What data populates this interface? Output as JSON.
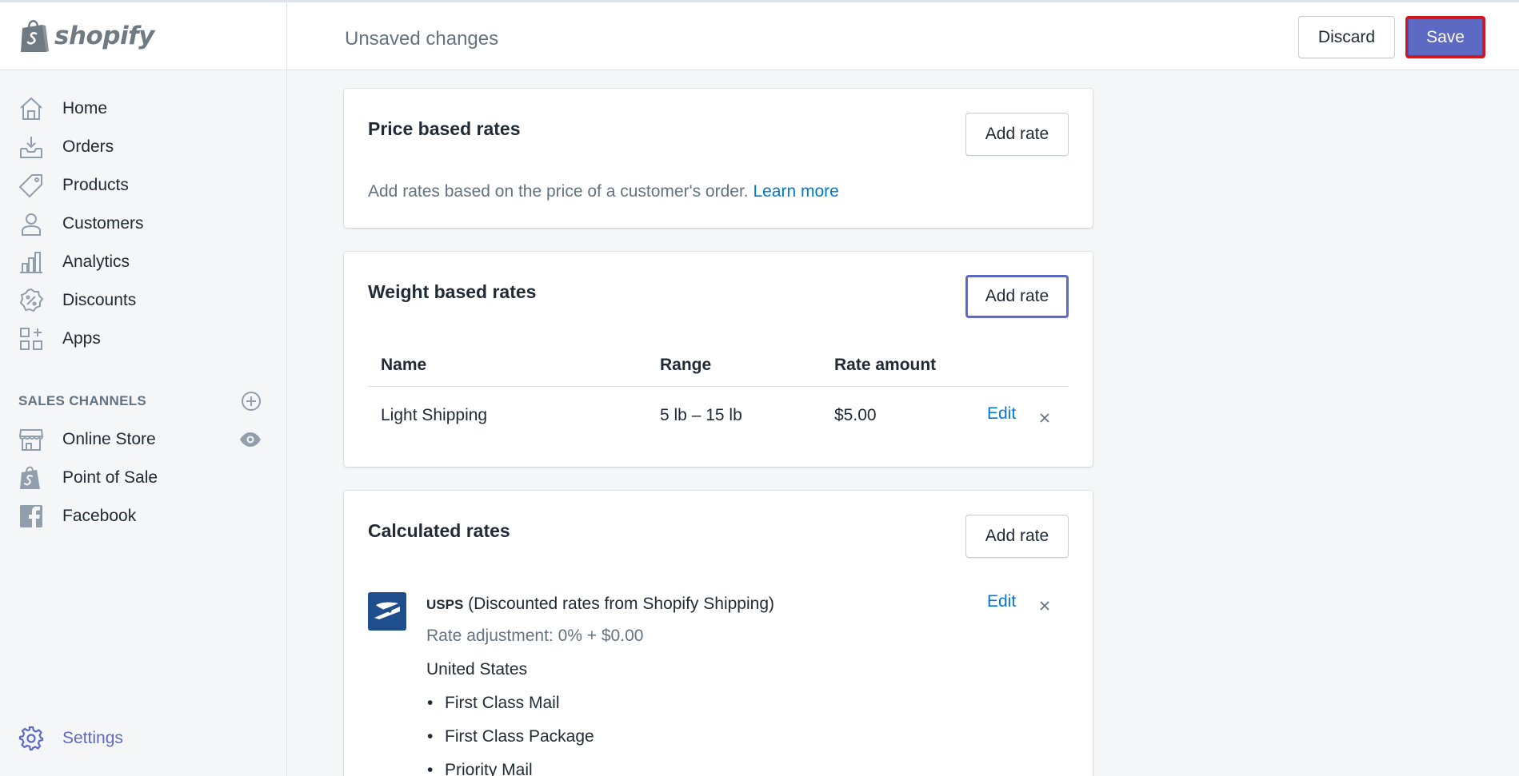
{
  "brand": {
    "name": "shopify"
  },
  "topbar": {
    "status": "Unsaved changes",
    "discard_label": "Discard",
    "save_label": "Save"
  },
  "sidebar": {
    "items": [
      {
        "label": "Home",
        "icon": "home-icon"
      },
      {
        "label": "Orders",
        "icon": "orders-icon"
      },
      {
        "label": "Products",
        "icon": "tag-icon"
      },
      {
        "label": "Customers",
        "icon": "person-icon"
      },
      {
        "label": "Analytics",
        "icon": "bar-chart-icon"
      },
      {
        "label": "Discounts",
        "icon": "discount-icon"
      },
      {
        "label": "Apps",
        "icon": "apps-icon"
      }
    ],
    "sales_channels_title": "SALES CHANNELS",
    "channels": [
      {
        "label": "Online Store",
        "icon": "store-icon"
      },
      {
        "label": "Point of Sale",
        "icon": "shopify-bag-icon"
      },
      {
        "label": "Facebook",
        "icon": "facebook-icon"
      }
    ],
    "settings_label": "Settings"
  },
  "price_rates": {
    "title": "Price based rates",
    "add_label": "Add rate",
    "description": "Add rates based on the price of a customer's order.",
    "learn_more": "Learn more"
  },
  "weight_rates": {
    "title": "Weight based rates",
    "add_label": "Add rate",
    "columns": [
      "Name",
      "Range",
      "Rate amount"
    ],
    "rows": [
      {
        "name": "Light Shipping",
        "range": "5 lb – 15 lb",
        "amount": "$5.00",
        "edit": "Edit"
      }
    ]
  },
  "calculated_rates": {
    "title": "Calculated rates",
    "add_label": "Add rate",
    "carrier": "USPS",
    "carrier_note": "(Discounted rates from Shopify Shipping)",
    "adjustment": "Rate adjustment: 0% + $0.00",
    "country": "United States",
    "services": [
      "First Class Mail",
      "First Class Package",
      "Priority Mail"
    ],
    "edit": "Edit"
  },
  "colors": {
    "accent": "#5c6ac4",
    "link": "#007ace",
    "save_outline": "#d4151c"
  }
}
